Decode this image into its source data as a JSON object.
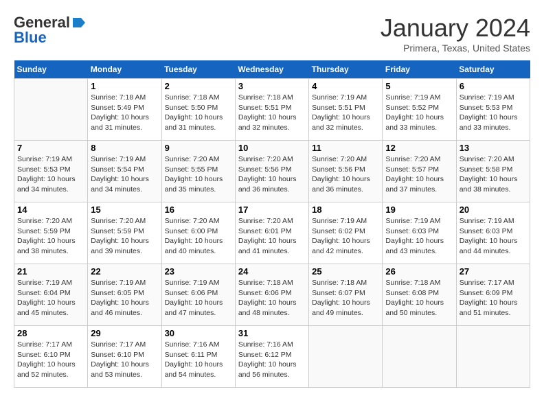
{
  "header": {
    "logo_general": "General",
    "logo_blue": "Blue",
    "title": "January 2024",
    "subtitle": "Primera, Texas, United States"
  },
  "columns": [
    "Sunday",
    "Monday",
    "Tuesday",
    "Wednesday",
    "Thursday",
    "Friday",
    "Saturday"
  ],
  "weeks": [
    [
      {
        "day": "",
        "info": ""
      },
      {
        "day": "1",
        "info": "Sunrise: 7:18 AM\nSunset: 5:49 PM\nDaylight: 10 hours\nand 31 minutes."
      },
      {
        "day": "2",
        "info": "Sunrise: 7:18 AM\nSunset: 5:50 PM\nDaylight: 10 hours\nand 31 minutes."
      },
      {
        "day": "3",
        "info": "Sunrise: 7:18 AM\nSunset: 5:51 PM\nDaylight: 10 hours\nand 32 minutes."
      },
      {
        "day": "4",
        "info": "Sunrise: 7:19 AM\nSunset: 5:51 PM\nDaylight: 10 hours\nand 32 minutes."
      },
      {
        "day": "5",
        "info": "Sunrise: 7:19 AM\nSunset: 5:52 PM\nDaylight: 10 hours\nand 33 minutes."
      },
      {
        "day": "6",
        "info": "Sunrise: 7:19 AM\nSunset: 5:53 PM\nDaylight: 10 hours\nand 33 minutes."
      }
    ],
    [
      {
        "day": "7",
        "info": "Sunrise: 7:19 AM\nSunset: 5:53 PM\nDaylight: 10 hours\nand 34 minutes."
      },
      {
        "day": "8",
        "info": "Sunrise: 7:19 AM\nSunset: 5:54 PM\nDaylight: 10 hours\nand 34 minutes."
      },
      {
        "day": "9",
        "info": "Sunrise: 7:20 AM\nSunset: 5:55 PM\nDaylight: 10 hours\nand 35 minutes."
      },
      {
        "day": "10",
        "info": "Sunrise: 7:20 AM\nSunset: 5:56 PM\nDaylight: 10 hours\nand 36 minutes."
      },
      {
        "day": "11",
        "info": "Sunrise: 7:20 AM\nSunset: 5:56 PM\nDaylight: 10 hours\nand 36 minutes."
      },
      {
        "day": "12",
        "info": "Sunrise: 7:20 AM\nSunset: 5:57 PM\nDaylight: 10 hours\nand 37 minutes."
      },
      {
        "day": "13",
        "info": "Sunrise: 7:20 AM\nSunset: 5:58 PM\nDaylight: 10 hours\nand 38 minutes."
      }
    ],
    [
      {
        "day": "14",
        "info": "Sunrise: 7:20 AM\nSunset: 5:59 PM\nDaylight: 10 hours\nand 38 minutes."
      },
      {
        "day": "15",
        "info": "Sunrise: 7:20 AM\nSunset: 5:59 PM\nDaylight: 10 hours\nand 39 minutes."
      },
      {
        "day": "16",
        "info": "Sunrise: 7:20 AM\nSunset: 6:00 PM\nDaylight: 10 hours\nand 40 minutes."
      },
      {
        "day": "17",
        "info": "Sunrise: 7:20 AM\nSunset: 6:01 PM\nDaylight: 10 hours\nand 41 minutes."
      },
      {
        "day": "18",
        "info": "Sunrise: 7:19 AM\nSunset: 6:02 PM\nDaylight: 10 hours\nand 42 minutes."
      },
      {
        "day": "19",
        "info": "Sunrise: 7:19 AM\nSunset: 6:03 PM\nDaylight: 10 hours\nand 43 minutes."
      },
      {
        "day": "20",
        "info": "Sunrise: 7:19 AM\nSunset: 6:03 PM\nDaylight: 10 hours\nand 44 minutes."
      }
    ],
    [
      {
        "day": "21",
        "info": "Sunrise: 7:19 AM\nSunset: 6:04 PM\nDaylight: 10 hours\nand 45 minutes."
      },
      {
        "day": "22",
        "info": "Sunrise: 7:19 AM\nSunset: 6:05 PM\nDaylight: 10 hours\nand 46 minutes."
      },
      {
        "day": "23",
        "info": "Sunrise: 7:19 AM\nSunset: 6:06 PM\nDaylight: 10 hours\nand 47 minutes."
      },
      {
        "day": "24",
        "info": "Sunrise: 7:18 AM\nSunset: 6:06 PM\nDaylight: 10 hours\nand 48 minutes."
      },
      {
        "day": "25",
        "info": "Sunrise: 7:18 AM\nSunset: 6:07 PM\nDaylight: 10 hours\nand 49 minutes."
      },
      {
        "day": "26",
        "info": "Sunrise: 7:18 AM\nSunset: 6:08 PM\nDaylight: 10 hours\nand 50 minutes."
      },
      {
        "day": "27",
        "info": "Sunrise: 7:17 AM\nSunset: 6:09 PM\nDaylight: 10 hours\nand 51 minutes."
      }
    ],
    [
      {
        "day": "28",
        "info": "Sunrise: 7:17 AM\nSunset: 6:10 PM\nDaylight: 10 hours\nand 52 minutes."
      },
      {
        "day": "29",
        "info": "Sunrise: 7:17 AM\nSunset: 6:10 PM\nDaylight: 10 hours\nand 53 minutes."
      },
      {
        "day": "30",
        "info": "Sunrise: 7:16 AM\nSunset: 6:11 PM\nDaylight: 10 hours\nand 54 minutes."
      },
      {
        "day": "31",
        "info": "Sunrise: 7:16 AM\nSunset: 6:12 PM\nDaylight: 10 hours\nand 56 minutes."
      },
      {
        "day": "",
        "info": ""
      },
      {
        "day": "",
        "info": ""
      },
      {
        "day": "",
        "info": ""
      }
    ]
  ]
}
